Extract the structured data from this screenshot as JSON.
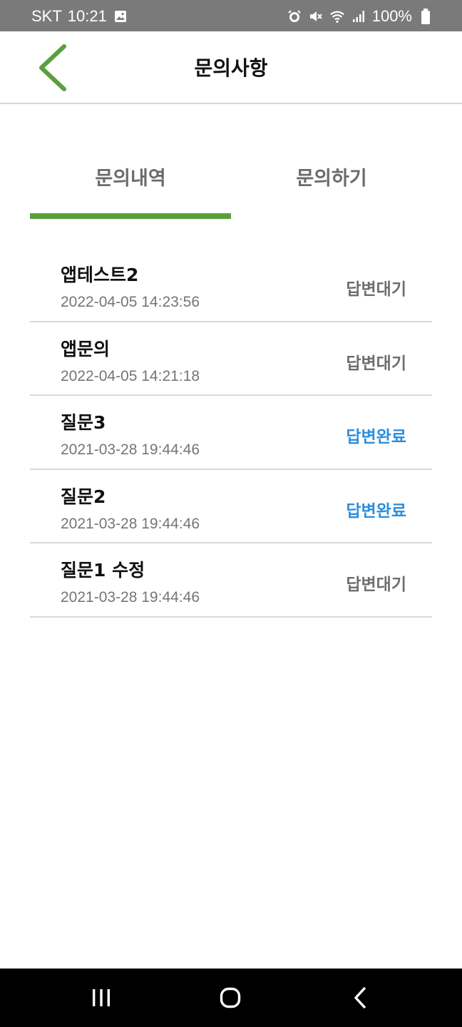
{
  "status_bar": {
    "carrier": "SKT",
    "time": "10:21",
    "battery": "100%",
    "icons": [
      "gallery-icon",
      "alarm-icon",
      "mute-icon",
      "wifi-icon",
      "signal-icon",
      "battery-icon"
    ]
  },
  "header": {
    "title": "문의사항",
    "back_icon": "chevron-left-icon",
    "accent_color": "#5b9f3c"
  },
  "tabs": [
    {
      "label": "문의내역",
      "active": true
    },
    {
      "label": "문의하기",
      "active": false
    }
  ],
  "inquiries": [
    {
      "title": "앱테스트2",
      "date": "2022-04-05 14:23:56",
      "status": "답변대기",
      "status_color": "#6e6e6e"
    },
    {
      "title": "앱문의",
      "date": "2022-04-05 14:21:18",
      "status": "답변대기",
      "status_color": "#6e6e6e"
    },
    {
      "title": "질문3",
      "date": "2021-03-28 19:44:46",
      "status": "답변완료",
      "status_color": "#2e8fdc"
    },
    {
      "title": "질문2",
      "date": "2021-03-28 19:44:46",
      "status": "답변완료",
      "status_color": "#2e8fdc"
    },
    {
      "title": "질문1 수정",
      "date": "2021-03-28 19:44:46",
      "status": "답변대기",
      "status_color": "#6e6e6e"
    }
  ],
  "nav_bar": {
    "icons": [
      "recent-apps-icon",
      "home-icon",
      "back-icon"
    ]
  }
}
